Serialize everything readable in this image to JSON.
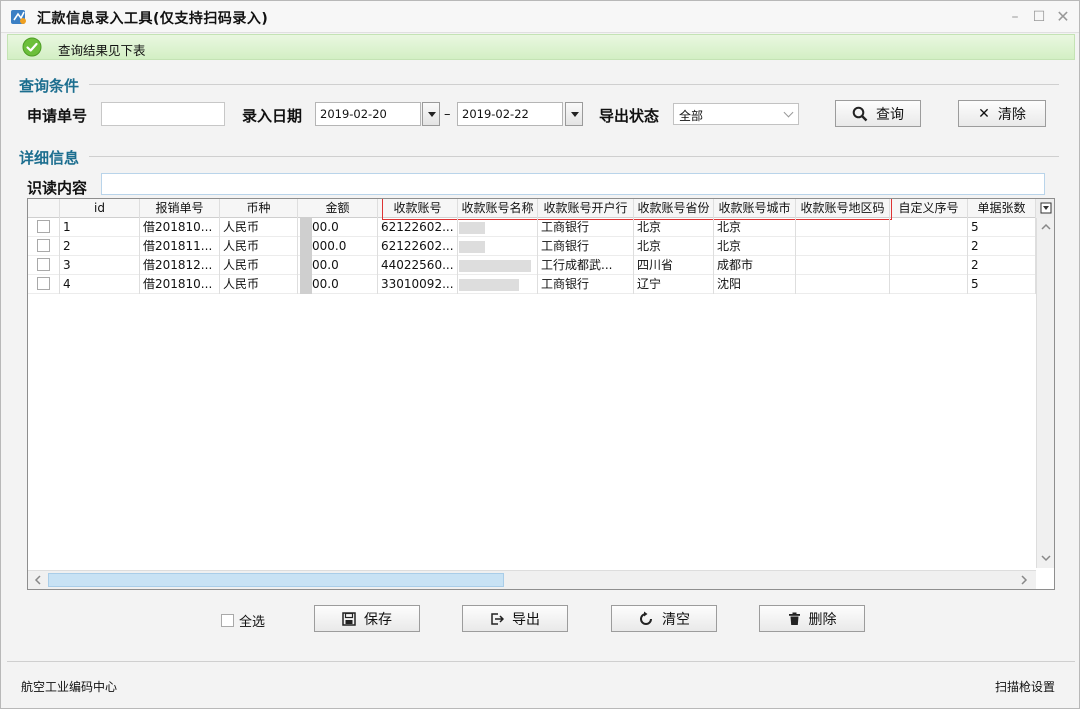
{
  "window": {
    "title": "汇款信息录入工具(仅支持扫码录入)",
    "minimize": "–",
    "maximize": "☐",
    "close": "✕"
  },
  "status": {
    "message": "查询结果见下表",
    "color": "#6cbf3b"
  },
  "query": {
    "section_title": "查询条件",
    "application_no_label": "申请单号",
    "application_no_value": "",
    "entry_date_label": "录入日期",
    "date_from": "2019-02-20",
    "date_separator": "–",
    "date_to": "2019-02-22",
    "export_status_label": "导出状态",
    "export_status_value": "全部",
    "search_label": "查询",
    "clear_label": "清除"
  },
  "detail": {
    "section_title": "详细信息",
    "read_content_label": "识读内容",
    "read_content_value": ""
  },
  "table": {
    "columns": [
      "",
      "id",
      "报销单号",
      "币种",
      "金额",
      "收款账号",
      "收款账号名称",
      "收款账号开户行",
      "收款账号省份",
      "收款账号城市",
      "收款账号地区码",
      "自定义序号",
      "单据张数"
    ],
    "rows": [
      [
        "",
        "1",
        "借201810...",
        "人民币",
        "00.0",
        "62122602...",
        "",
        "工商银行",
        "北京",
        "北京",
        "",
        "",
        "5"
      ],
      [
        "",
        "2",
        "借201811...",
        "人民币",
        "000.0",
        "62122602...",
        "",
        "工商银行",
        "北京",
        "北京",
        "",
        "",
        "2"
      ],
      [
        "",
        "3",
        "借201812...",
        "人民币",
        "00.0",
        "44022560...",
        "",
        "工行成都武...",
        "四川省",
        "成都市",
        "",
        "",
        "2"
      ],
      [
        "",
        "4",
        "借201810...",
        "人民币",
        "00.0",
        "33010092...",
        "",
        "工商银行",
        "辽宁",
        "沈阳",
        "",
        "",
        "5"
      ]
    ],
    "accent_highlight": "#d33333"
  },
  "actions": {
    "select_all_label": "全选",
    "save_label": "保存",
    "export_label": "导出",
    "empty_label": "清空",
    "delete_label": "删除"
  },
  "footer": {
    "left": "航空工业编码中心",
    "right": "扫描枪设置"
  }
}
